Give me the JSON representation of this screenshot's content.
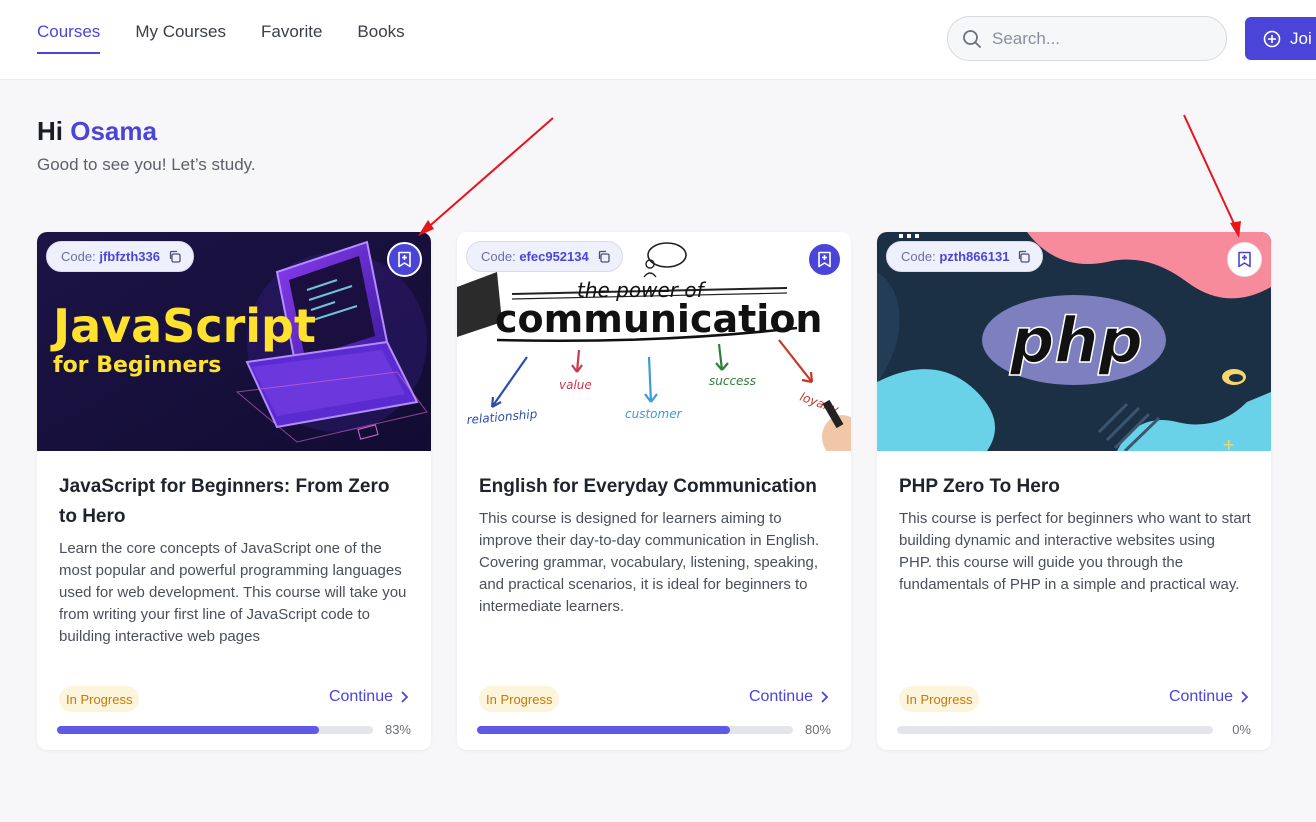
{
  "nav": {
    "tabs": [
      {
        "label": "Courses",
        "active": true
      },
      {
        "label": "My Courses",
        "active": false
      },
      {
        "label": "Favorite",
        "active": false
      },
      {
        "label": "Books",
        "active": false
      }
    ],
    "search_placeholder": "Search...",
    "join_label": "Joi"
  },
  "greeting": {
    "hi": "Hi",
    "name": "Osama",
    "subtitle": "Good to see you! Let’s study."
  },
  "courses": [
    {
      "code_label": "Code:",
      "code": "jfbfzth336",
      "image_text_1": "JavaScript",
      "image_text_2": "for Beginners",
      "title": "JavaScript for Beginners: From Zero to Hero",
      "description": "Learn the core concepts of JavaScript one of the most popular and powerful programming languages used for web development. This course will take you from writing your first line of JavaScript code to building interactive web pages",
      "status": "In Progress",
      "continue_label": "Continue",
      "progress": 0.83,
      "progress_label": "83%",
      "bookmarked": true
    },
    {
      "code_label": "Code:",
      "code": "efec952134",
      "image_text_1": "the power of",
      "image_text_2": "communication",
      "image_words": [
        "relationship",
        "value",
        "customer",
        "success",
        "loyalty"
      ],
      "title": "English for Everyday Communication",
      "description": "This course is designed for learners aiming to improve their day-to-day communication in English. Covering grammar, vocabulary, listening, speaking, and practical scenarios, it is ideal for beginners to intermediate learners.",
      "status": "In Progress",
      "continue_label": "Continue",
      "progress": 0.8,
      "progress_label": "80%",
      "bookmarked": true
    },
    {
      "code_label": "Code:",
      "code": "pzth866131",
      "image_text_1": "php",
      "title": "PHP Zero To Hero",
      "description": "This course is perfect for beginners who want to start building dynamic and interactive websites using PHP. this course will guide you through the fundamentals of PHP in a simple and practical way.",
      "status": "In Progress",
      "continue_label": "Continue",
      "progress": 0,
      "progress_label": "0%",
      "bookmarked": false
    }
  ],
  "colors": {
    "accent": "#4b44d8",
    "progress": "#5e59e6",
    "badge_bg": "#fdf4dc",
    "badge_text": "#c47a08",
    "annotation": "#e8141a"
  },
  "icons": {
    "search": "search-icon",
    "join": "plus-circle-icon",
    "copy": "copy-icon",
    "bookmark": "bookmark-plus-icon",
    "continue": "chevron-right-icon"
  }
}
